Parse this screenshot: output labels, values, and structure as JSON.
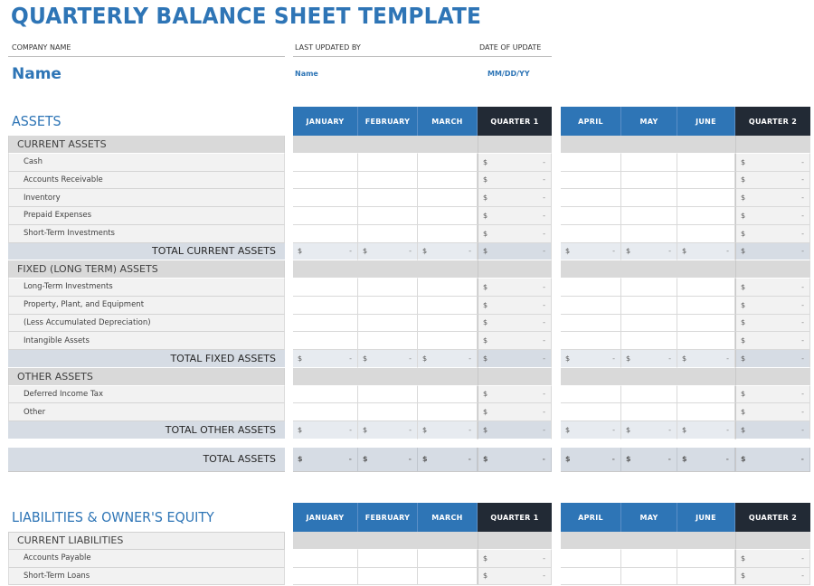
{
  "title": "QUARTERLY BALANCE SHEET TEMPLATE",
  "header": {
    "company_label": "COMPANY NAME",
    "company_value": "Name",
    "updated_by_label": "LAST UPDATED BY",
    "updated_by_value": "Name",
    "date_label": "DATE OF UPDATE",
    "date_value": "MM/DD/YY"
  },
  "colors": {
    "accent": "#2e75b6",
    "quarter_header": "#222a35",
    "section_gray": "#d9d9d9",
    "total_blue_gray": "#d6dce4"
  },
  "columns": {
    "q1": [
      "JANUARY",
      "FEBRUARY",
      "MARCH",
      "QUARTER 1"
    ],
    "q2": [
      "APRIL",
      "MAY",
      "JUNE",
      "QUARTER 2"
    ]
  },
  "currency_symbol": "$",
  "empty_value": "-",
  "assets": {
    "title": "ASSETS",
    "current": {
      "label": "CURRENT ASSETS",
      "items": [
        "Cash",
        "Accounts Receivable",
        "Inventory",
        "Prepaid Expenses",
        "Short-Term Investments"
      ],
      "total_label": "TOTAL CURRENT ASSETS"
    },
    "fixed": {
      "label": "FIXED (LONG TERM) ASSETS",
      "items": [
        "Long-Term Investments",
        "Property, Plant, and Equipment",
        "(Less Accumulated Depreciation)",
        "Intangible Assets"
      ],
      "total_label": "TOTAL FIXED ASSETS"
    },
    "other": {
      "label": "OTHER ASSETS",
      "items": [
        "Deferred Income Tax",
        "Other"
      ],
      "total_label": "TOTAL OTHER ASSETS"
    },
    "grand_total_label": "TOTAL ASSETS"
  },
  "liabilities": {
    "title": "LIABILITIES & OWNER'S EQUITY",
    "current": {
      "label": "CURRENT LIABILITIES",
      "items": [
        "Accounts Payable",
        "Short-Term Loans"
      ]
    }
  }
}
